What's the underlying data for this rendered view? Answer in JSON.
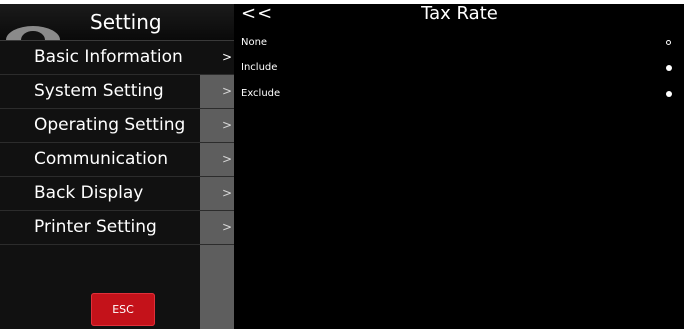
{
  "sidebar": {
    "title": "Setting",
    "items": [
      {
        "label": "Basic Information",
        "chevron": ">"
      },
      {
        "label": "System Setting",
        "chevron": ">"
      },
      {
        "label": "Operating Setting",
        "chevron": ">"
      },
      {
        "label": "Communication",
        "chevron": ">"
      },
      {
        "label": "Back Display",
        "chevron": ">"
      },
      {
        "label": "Printer Setting",
        "chevron": ">"
      }
    ],
    "esc_label": "ESC"
  },
  "panel": {
    "back_label": "<<",
    "title": "Tax Rate",
    "options": [
      {
        "label": "None",
        "selected": true
      },
      {
        "label": "Include",
        "selected": false
      },
      {
        "label": "Exclude",
        "selected": false
      }
    ]
  },
  "colors": {
    "background": "#000000",
    "sidebar": "#111111",
    "scroll_strip": "#5e5e5e",
    "esc_button": "#c4121a",
    "text": "#ffffff"
  }
}
